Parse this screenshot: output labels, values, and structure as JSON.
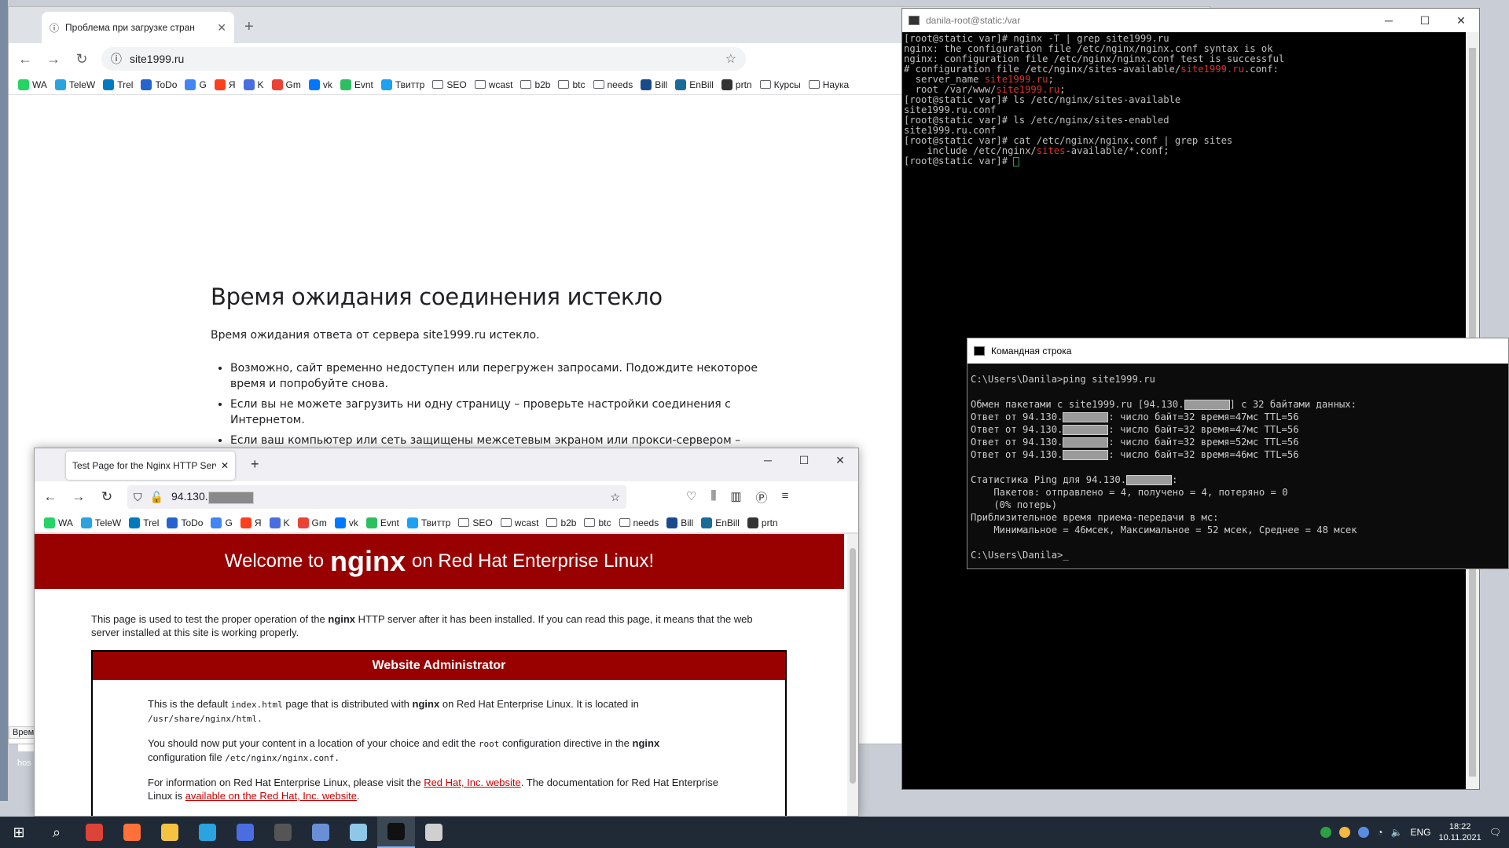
{
  "chrome": {
    "tab_title": "Проблема при загрузке стран",
    "url": "site1999.ru",
    "error_title": "Время ожидания соединения истекло",
    "error_desc": "Время ожидания ответа от сервера site1999.ru истекло.",
    "suggestions": [
      "Возможно, сайт временно недоступен или перегружен запросами. Подождите некоторое время и попробуйте снова.",
      "Если вы не можете загрузить ни одну страницу – проверьте настройки соединения с Интернетом.",
      "Если ваш компьютер или сеть защищены межсетевым экраном или прокси-сервером – убедитесь, что"
    ],
    "status_fragment": "Врем"
  },
  "bookmarks": [
    {
      "label": "WA",
      "icon": "whatsapp-icon",
      "color": "#25d366"
    },
    {
      "label": "TeleW",
      "icon": "telegram-icon",
      "color": "#2aa3de"
    },
    {
      "label": "Trel",
      "icon": "trello-icon",
      "color": "#0079bf"
    },
    {
      "label": "ToDo",
      "icon": "todo-icon",
      "color": "#2564cf"
    },
    {
      "label": "G",
      "icon": "google-icon",
      "color": "#4285f4"
    },
    {
      "label": "Я",
      "icon": "yandex-icon",
      "color": "#fc3f1d"
    },
    {
      "label": "K",
      "icon": "calendar-icon",
      "color": "#4a6ee0"
    },
    {
      "label": "Gm",
      "icon": "gmail-icon",
      "color": "#ea4335"
    },
    {
      "label": "vk",
      "icon": "vk-icon",
      "color": "#0077ff"
    },
    {
      "label": "Evnt",
      "icon": "evernote-icon",
      "color": "#2dbe60"
    },
    {
      "label": "Твиттр",
      "icon": "twitter-icon",
      "color": "#1da1f2"
    },
    {
      "label": "SEO",
      "icon": "folder-icon",
      "color": ""
    },
    {
      "label": "wcast",
      "icon": "folder-icon",
      "color": ""
    },
    {
      "label": "b2b",
      "icon": "folder-icon",
      "color": ""
    },
    {
      "label": "btc",
      "icon": "folder-icon",
      "color": ""
    },
    {
      "label": "needs",
      "icon": "folder-icon",
      "color": ""
    },
    {
      "label": "Bill",
      "icon": "bill-icon",
      "color": "#1a4a8a"
    },
    {
      "label": "EnBill",
      "icon": "enbill-icon",
      "color": "#1a6a9a"
    },
    {
      "label": "prtn",
      "icon": "prtn-icon",
      "color": "#333333"
    },
    {
      "label": "Курсы",
      "icon": "folder-icon",
      "color": ""
    },
    {
      "label": "Наука",
      "icon": "folder-icon",
      "color": ""
    }
  ],
  "firefox": {
    "tab_title": "Test Page for the Nginx HTTP Server",
    "url_prefix": "94.130.",
    "banner_prefix": "Welcome to",
    "banner_brand": "nginx",
    "banner_suffix": "on Red Hat Enterprise Linux!",
    "intro_1": "This page is used to test the proper operation of the",
    "intro_bold": "nginx",
    "intro_2": "HTTP server after it has been installed. If you can read this page, it means that the web server installed at this site is working properly.",
    "box_title": "Website Administrator",
    "p1_a": "This is the default",
    "p1_code": "index.html",
    "p1_b": "page that is distributed with",
    "p1_bold": "nginx",
    "p1_c": "on Red Hat Enterprise Linux. It is located in",
    "p1_path": "/usr/share/nginx/html.",
    "p2_a": "You should now put your content in a location of your choice and edit the",
    "p2_code": "root",
    "p2_b": "configuration directive in the",
    "p2_bold": "nginx",
    "p2_c": "configuration file",
    "p2_path": "/etc/nginx/nginx.conf.",
    "p3_a": "For information on Red Hat Enterprise Linux, please visit the",
    "p3_link1": "Red Hat, Inc. website",
    "p3_b": ". The documentation for Red Hat Enterprise Linux is",
    "p3_link2": "available on the Red Hat, Inc. website",
    "p3_c": "."
  },
  "putty": {
    "title": "danila-root@static:/var",
    "prompt": "[root@static var]#",
    "l1_cmd": " nginx -T | grep site1999.ru",
    "l2": "nginx: the configuration file /etc/nginx/nginx.conf syntax is ok",
    "l3": "nginx: configuration file /etc/nginx/nginx.conf test is successful",
    "l4_a": "# configuration file /etc/nginx/sites-available/",
    "l4_r": "site1999.ru",
    "l4_b": ".conf:",
    "l5_a": "  server_name ",
    "l5_r": "site1999.ru",
    "l5_b": ";",
    "l6_a": "  root /var/www/",
    "l6_r": "site1999.ru",
    "l6_b": ";",
    "l7_cmd": " ls /etc/nginx/sites-available",
    "l8": "site1999.ru.conf",
    "l9_cmd": " ls /etc/nginx/sites-enabled",
    "l10": "site1999.ru.conf",
    "l11_cmd": " cat /etc/nginx/nginx.conf | grep sites",
    "l12_a": "    include /etc/nginx/",
    "l12_r": "sites",
    "l12_b": "-available/*.conf;"
  },
  "cmd": {
    "title": "Командная строка",
    "line1": "C:\\Users\\Danila>ping site1999.ru",
    "exch_a": "Обмен пакетами с site1999.ru [94.130.",
    "exch_b": "] с 32 байтами данных:",
    "reply_prefix": "Ответ от 94.130.",
    "replies": [
      ": число байт=32 время=47мс TTL=56",
      ": число байт=32 время=47мс TTL=56",
      ": число байт=32 время=52мс TTL=56",
      ": число байт=32 время=46мс TTL=56"
    ],
    "stats_a": "Статистика Ping для 94.130.",
    "stats_b": ":",
    "packets": "    Пакетов: отправлено = 4, получено = 4, потеряно = 0",
    "loss": "    (0% потерь)",
    "rtt_head": "Приблизительное время приема-передачи в мс:",
    "rtt": "    Минимальное = 46мсек, Максимальное = 52 мсек, Среднее = 48 мсек",
    "final_prompt": "C:\\Users\\Danila>"
  },
  "desktop": {
    "icon_label": "hos"
  },
  "taskbar": {
    "lang": "ENG",
    "time": "18:22",
    "date": "10.11.2021",
    "apps": [
      {
        "name": "chrome",
        "color": "#db4437"
      },
      {
        "name": "firefox",
        "color": "#ff7139"
      },
      {
        "name": "explorer",
        "color": "#f5c342"
      },
      {
        "name": "telegram",
        "color": "#2aa3de"
      },
      {
        "name": "calculator",
        "color": "#4a6ee0"
      },
      {
        "name": "terminal",
        "color": "#555555"
      },
      {
        "name": "network",
        "color": "#6b8fd6"
      },
      {
        "name": "notepad",
        "color": "#8fc7e8"
      },
      {
        "name": "cmd",
        "color": "#111111"
      },
      {
        "name": "paint",
        "color": "#d0d0d0"
      }
    ]
  }
}
